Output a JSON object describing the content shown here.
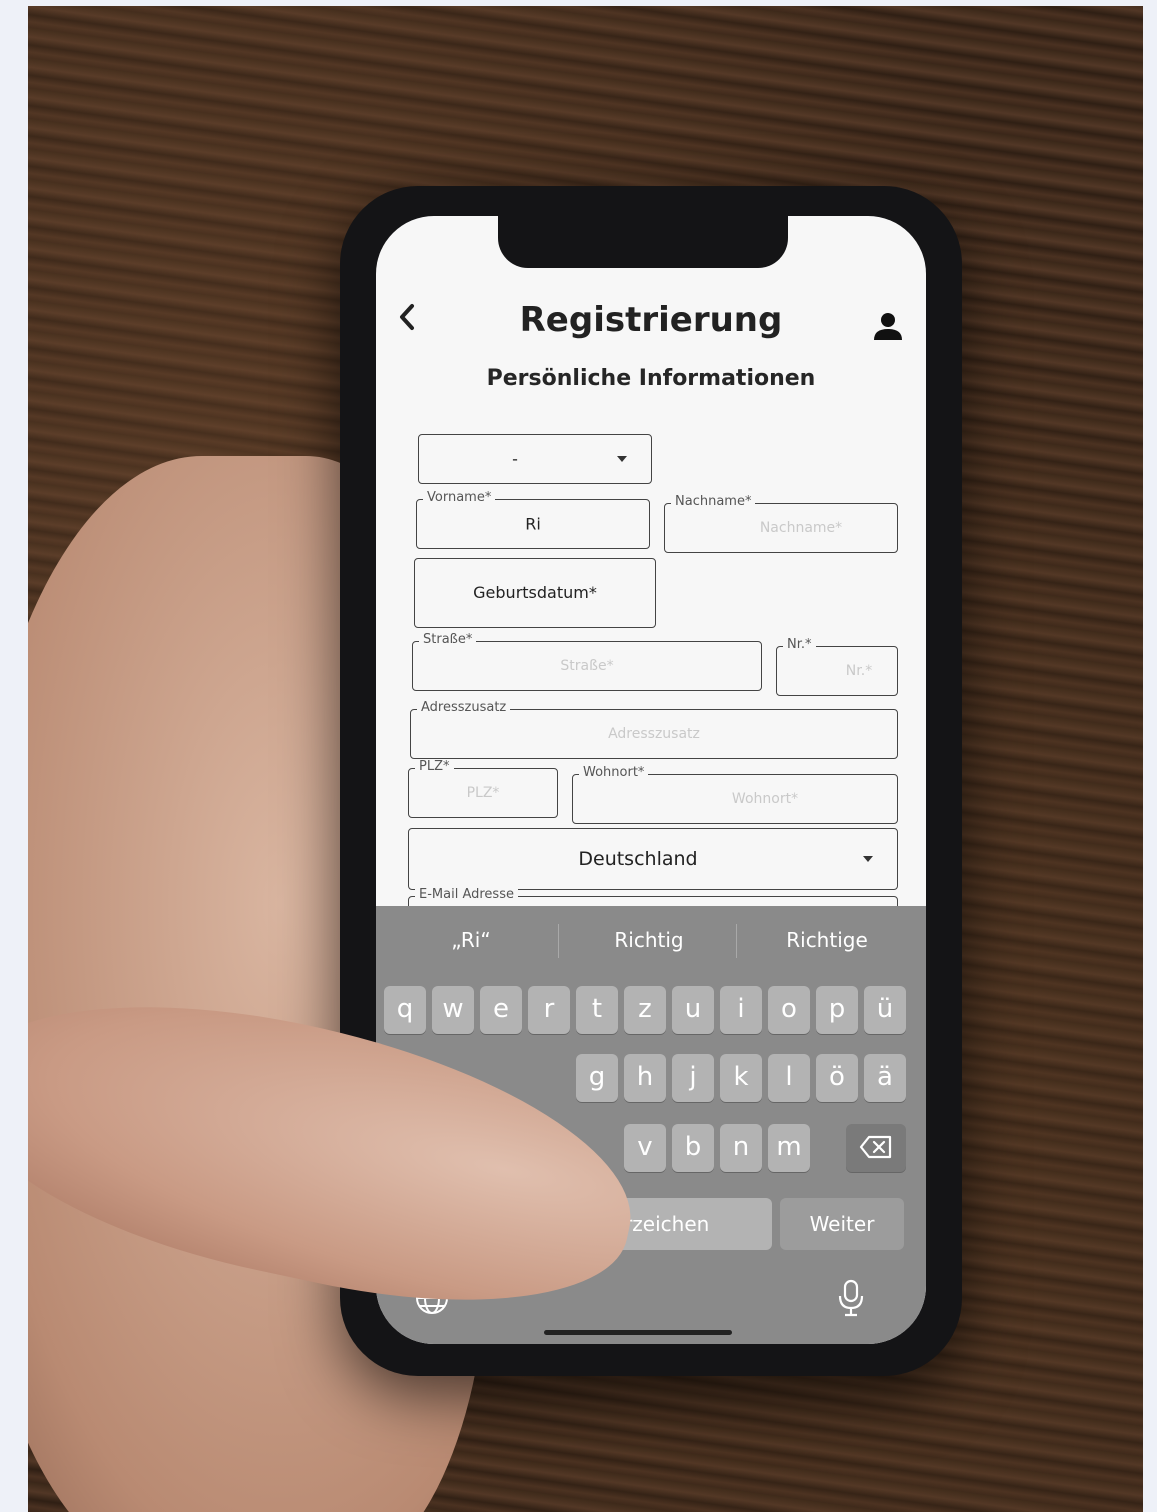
{
  "header": {
    "back_icon": "chevron-left-icon",
    "title": "Registrierung",
    "profile_icon": "user-icon"
  },
  "section_title": "Persönliche Informationen",
  "form": {
    "salutation": {
      "value": "-"
    },
    "vorname": {
      "label": "Vorname*",
      "value": "Ri"
    },
    "nachname": {
      "label": "Nachname*",
      "placeholder": "Nachname*"
    },
    "geburtsdatum": {
      "label": "Geburtsdatum*"
    },
    "strasse": {
      "label": "Straße*",
      "placeholder": "Straße*"
    },
    "nr": {
      "label": "Nr.*",
      "placeholder": "Nr.*"
    },
    "adresszusatz": {
      "label": "Adresszusatz",
      "placeholder": "Adresszusatz"
    },
    "plz": {
      "label": "PLZ*",
      "placeholder": "PLZ*"
    },
    "wohnort": {
      "label": "Wohnort*",
      "placeholder": "Wohnort*"
    },
    "land": {
      "value": "Deutschland"
    },
    "email": {
      "label": "E-Mail Adresse"
    }
  },
  "keyboard": {
    "suggestions": [
      "„Ri“",
      "Richtig",
      "Richtige"
    ],
    "row1": [
      "q",
      "w",
      "e",
      "r",
      "t",
      "z",
      "u",
      "i",
      "o",
      "p",
      "ü"
    ],
    "row2": [
      "g",
      "h",
      "j",
      "k",
      "l",
      "ö",
      "ä"
    ],
    "row3": [
      "v",
      "b",
      "n",
      "m"
    ],
    "backspace_icon": "backspace-icon",
    "space_label": "Leerzeichen",
    "next_label": "Weiter",
    "globe_icon": "globe-icon",
    "mic_icon": "microphone-icon"
  }
}
